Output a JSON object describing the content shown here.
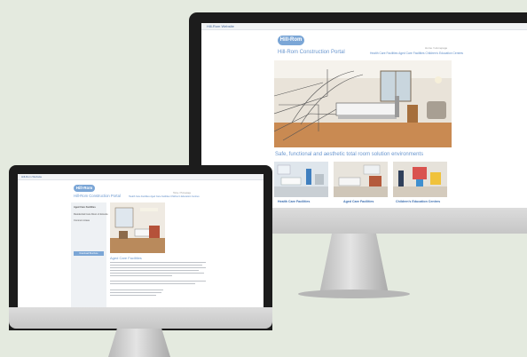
{
  "big_site": {
    "topbar_text": "Hill-Rom Website",
    "logo": "Hill-Rom",
    "breadcrumb": "Home  /  Homepage",
    "title": "Hill-Rom Construction Portal",
    "nav": "Health Care Facilities   Aged Care Facilities   Children's Education Centres",
    "heading": "Safe, functional and aesthetic total room solution environments",
    "cards": [
      {
        "label": "Health Care Facilities"
      },
      {
        "label": "Aged Care Facilities"
      },
      {
        "label": "Children's Education Centres"
      }
    ]
  },
  "small_site": {
    "topbar_text": "Hill-Rom Website",
    "logo": "Hill-Rom",
    "breadcrumb": "Home  /  Homepage",
    "title": "Hill-Rom Construction Portal",
    "nav": "Health Care Facilities   Aged Care Facilities   Children's Education Centres",
    "sidebar": {
      "heading": "Aged Care Facilities",
      "items": [
        "Residential Care Room & Ensuite",
        "Common Areas"
      ],
      "button": "Download Brochure"
    },
    "heading": "Aged Care Facilities"
  },
  "colors": {
    "accent": "#6a97cf",
    "logo_bg": "#7ba6d6",
    "background": "#e4eadf"
  }
}
